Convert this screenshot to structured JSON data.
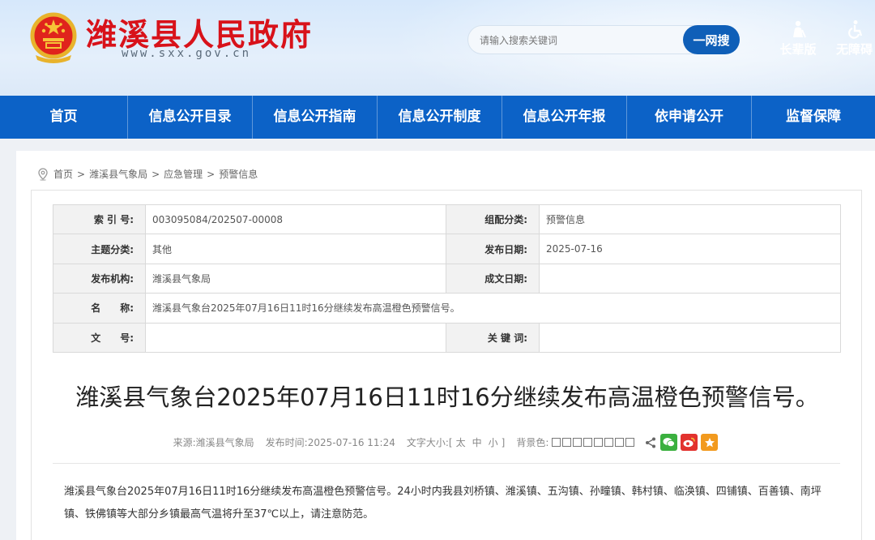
{
  "header": {
    "site_title": "潍溪县人民政府",
    "site_url": "www.sxx.gov.cn",
    "search": {
      "placeholder": "请输入搜索关键词",
      "button": "一网搜"
    },
    "tools": {
      "elder": "长辈版",
      "accessible": "无障碍"
    }
  },
  "nav": [
    "首页",
    "信息公开目录",
    "信息公开指南",
    "信息公开制度",
    "信息公开年报",
    "依申请公开",
    "监督保障"
  ],
  "breadcrumb": [
    "首页",
    "潍溪县气象局",
    "应急管理",
    "预警信息"
  ],
  "breadcrumb_sep": ">",
  "meta": {
    "index_no_label": "索 引 号:",
    "index_no": "003095084/202507-00008",
    "category_label": "组配分类:",
    "category": "预警信息",
    "topic_label": "主题分类:",
    "topic": "其他",
    "publish_date_label": "发布日期:",
    "publish_date": "2025-07-16",
    "org_label": "发布机构:",
    "org": "潍溪县气象局",
    "created_label": "成文日期:",
    "created": "",
    "name_label": "名　　称:",
    "name": "潍溪县气象台2025年07月16日11时16分继续发布高温橙色预警信号。",
    "doc_no_label": "文　　号:",
    "doc_no": "",
    "keywords_label": "关 键 词:",
    "keywords": ""
  },
  "article": {
    "title": "潍溪县气象台2025年07月16日11时16分继续发布高温橙色预警信号。",
    "source_label": "来源:",
    "source": "潍溪县气象局",
    "time_label": "发布时间:",
    "time": "2025-07-16 11:24",
    "font_label": "文字大小:",
    "font_open": "[",
    "font_large": "太",
    "font_medium": "中",
    "font_small": "小",
    "font_close": "]",
    "bg_label": "背景色:",
    "body": "潍溪县气象台2025年07月16日11时16分继续发布高温橙色预警信号。24小时内我县刘桥镇、潍溪镇、五沟镇、孙疃镇、韩村镇、临涣镇、四铺镇、百善镇、南坪镇、铁佛镇等大部分乡镇最高气温将升至37℃以上，请注意防范。"
  },
  "colors": {
    "brand_red": "#d8121a",
    "nav_blue": "#0c62c7",
    "wechat": "#3bb03f",
    "weibo": "#e2322e",
    "favorite": "#f29a1e"
  }
}
